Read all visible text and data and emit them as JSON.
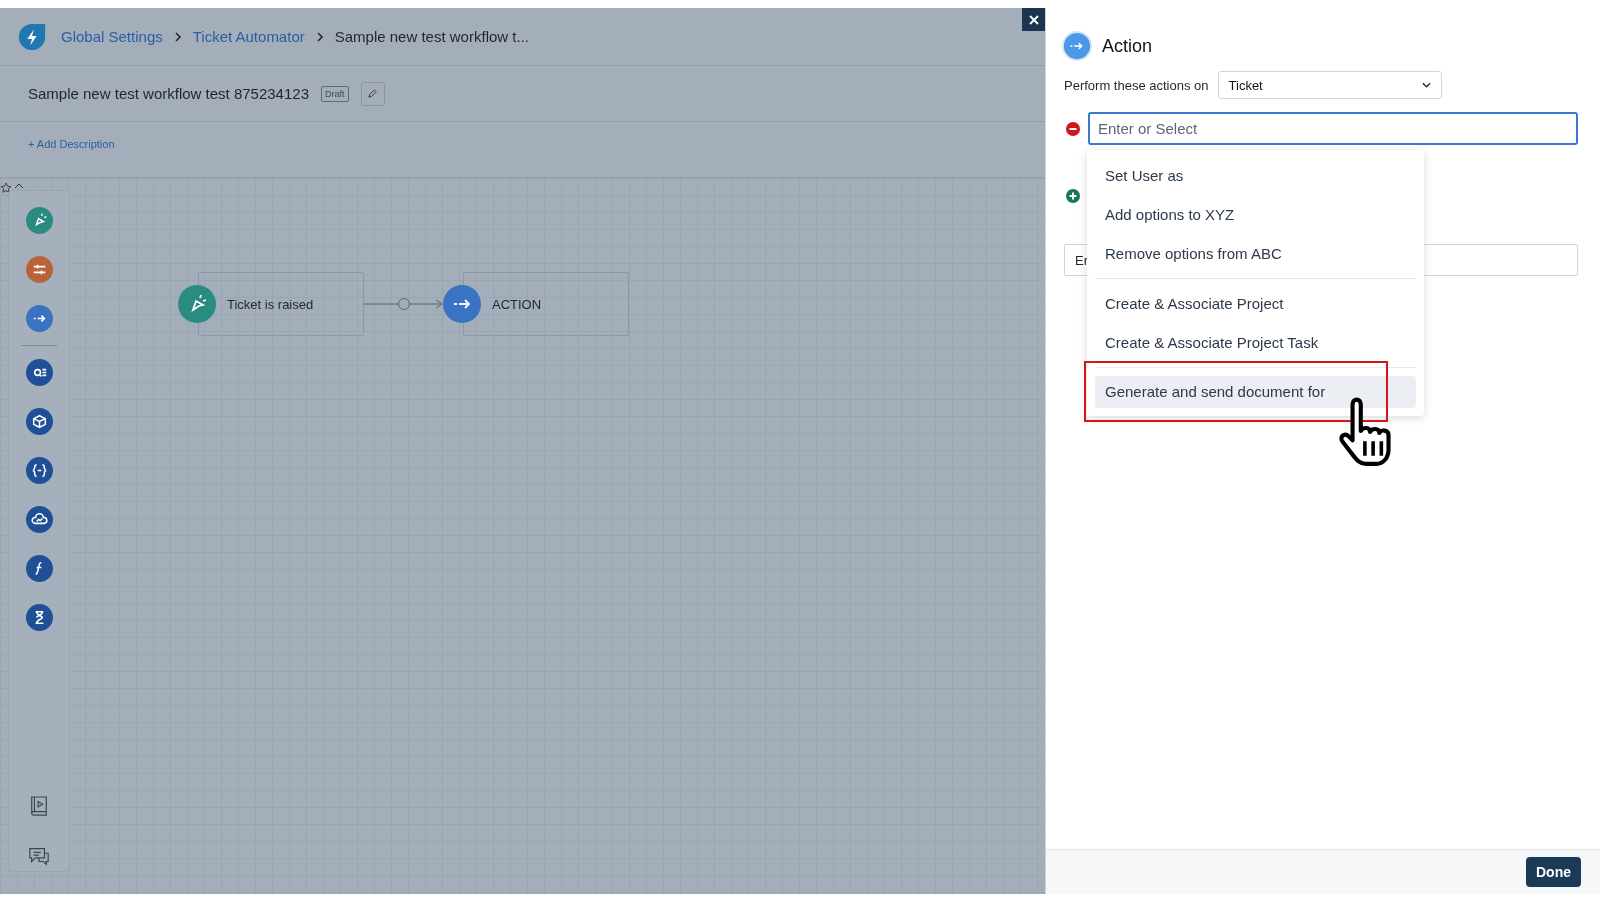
{
  "breadcrumb": [
    {
      "label": "Global Settings",
      "kind": "link"
    },
    {
      "label": "Ticket Automator",
      "kind": "link"
    },
    {
      "label": "Sample new test workflow t...",
      "kind": "current"
    }
  ],
  "workflow": {
    "title": "Sample new test workflow test 875234123",
    "status": "Draft",
    "add_description": "+ Add Description"
  },
  "palette": [
    {
      "kind": "trigger",
      "color": "#2a8c7e"
    },
    {
      "kind": "condition",
      "color": "#b8643a"
    },
    {
      "kind": "action",
      "color": "#3a73c2"
    },
    {
      "kind": "search",
      "color": "#1f4f96"
    },
    {
      "kind": "box",
      "color": "#1f4f96"
    },
    {
      "kind": "braces",
      "color": "#1f4f96"
    },
    {
      "kind": "cloud",
      "color": "#1f4f96"
    },
    {
      "kind": "function",
      "color": "#1f4f96"
    },
    {
      "kind": "timer",
      "color": "#1f4f96"
    }
  ],
  "nodes": [
    {
      "label": "Ticket is raised",
      "kind": "trigger",
      "color": "#2a8c7e"
    },
    {
      "label": "ACTION",
      "kind": "action",
      "color": "#3a73c2"
    }
  ],
  "panel": {
    "title": "Action",
    "perform_label": "Perform these actions on",
    "object_select": {
      "value": "Ticket"
    },
    "action_field": {
      "placeholder": "Enter or Select"
    },
    "dropdown": [
      [
        {
          "label": "Set User as",
          "selected": false,
          "outlined": false
        },
        {
          "label": "Add options to XYZ",
          "selected": false,
          "outlined": false
        },
        {
          "label": "Remove options from ABC",
          "selected": false,
          "outlined": false
        }
      ],
      [
        {
          "label": "Create & Associate Project",
          "selected": false,
          "outlined": false
        },
        {
          "label": "Create & Associate Project Task",
          "selected": false,
          "outlined": false
        }
      ],
      [
        {
          "label": "Generate and send document for",
          "selected": true,
          "outlined": true
        }
      ]
    ],
    "second_field": {
      "value": "Er"
    },
    "done": "Done"
  }
}
